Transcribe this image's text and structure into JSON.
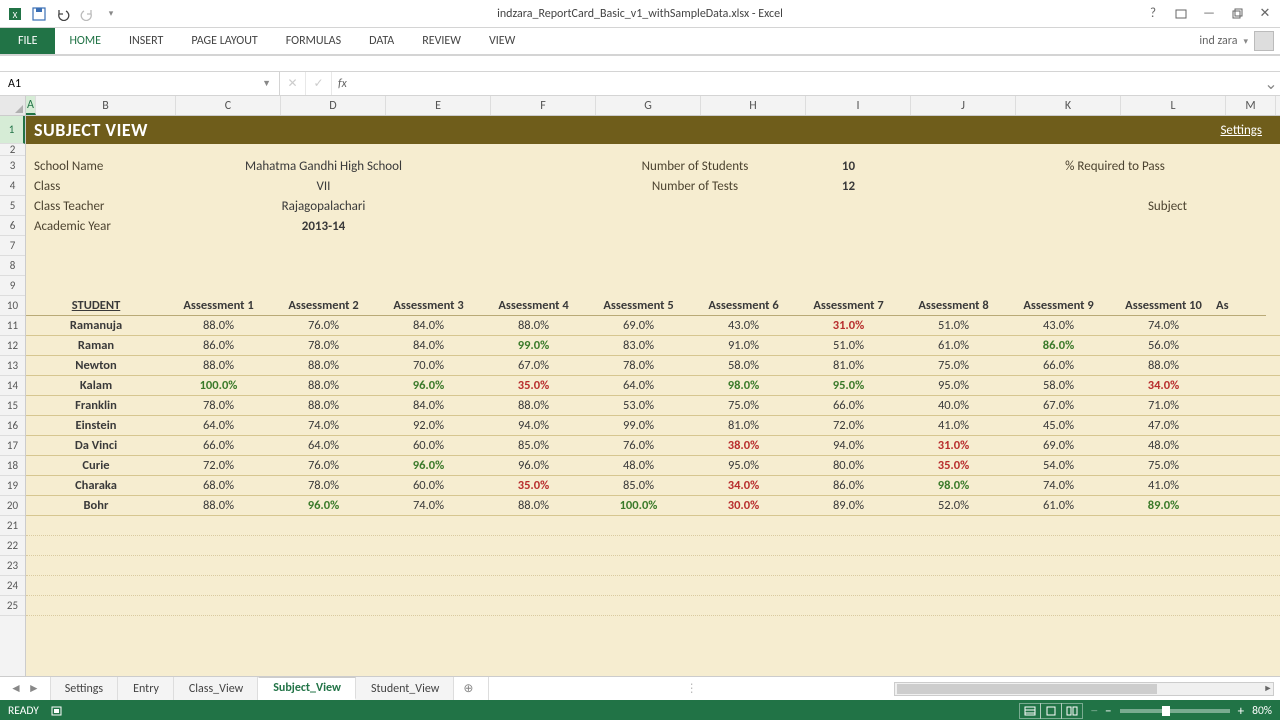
{
  "app": {
    "title_full": "indzara_ReportCard_Basic_v1_withSampleData.xlsx - Excel",
    "user_name": "ind zara"
  },
  "ribbon": {
    "file": "FILE",
    "tabs": [
      "HOME",
      "INSERT",
      "PAGE LAYOUT",
      "FORMULAS",
      "DATA",
      "REVIEW",
      "VIEW"
    ]
  },
  "formula_bar": {
    "name_box": "A1",
    "fx_label": "fx",
    "formula": ""
  },
  "columns": [
    "A",
    "B",
    "C",
    "D",
    "E",
    "F",
    "G",
    "H",
    "I",
    "J",
    "K",
    "L",
    "M"
  ],
  "sheet": {
    "title": "SUBJECT VIEW",
    "settings_link": "Settings",
    "info_labels": {
      "school": "School Name",
      "class": "Class",
      "teacher": "Class Teacher",
      "year": "Academic Year",
      "num_students": "Number of Students",
      "num_tests": "Number of Tests",
      "pct_pass": "% Required to Pass",
      "subject": "Subject"
    },
    "info_values": {
      "school": "Mahatma Gandhi High School",
      "class": "VII",
      "teacher": "Rajagopalachari",
      "year": "2013-14",
      "num_students": "10",
      "num_tests": "12"
    },
    "headers": [
      "STUDENT",
      "Assessment 1",
      "Assessment 2",
      "Assessment 3",
      "Assessment 4",
      "Assessment 5",
      "Assessment 6",
      "Assessment 7",
      "Assessment 8",
      "Assessment 9",
      "Assessment 10",
      "As"
    ],
    "students": [
      {
        "name": "Ramanuja",
        "v": [
          "88.0%",
          "76.0%",
          "84.0%",
          "88.0%",
          "69.0%",
          "43.0%",
          "31.0%",
          "51.0%",
          "43.0%",
          "74.0%"
        ],
        "c": [
          "",
          "",
          "",
          "",
          "",
          "",
          "red",
          "",
          "",
          ""
        ]
      },
      {
        "name": "Raman",
        "v": [
          "86.0%",
          "78.0%",
          "84.0%",
          "99.0%",
          "83.0%",
          "91.0%",
          "51.0%",
          "61.0%",
          "86.0%",
          "56.0%"
        ],
        "c": [
          "",
          "",
          "",
          "green",
          "",
          "",
          "",
          "",
          "green",
          ""
        ]
      },
      {
        "name": "Newton",
        "v": [
          "88.0%",
          "88.0%",
          "70.0%",
          "67.0%",
          "78.0%",
          "58.0%",
          "81.0%",
          "75.0%",
          "66.0%",
          "88.0%"
        ],
        "c": [
          "",
          "",
          "",
          "",
          "",
          "",
          "",
          "",
          "",
          ""
        ]
      },
      {
        "name": "Kalam",
        "v": [
          "100.0%",
          "88.0%",
          "96.0%",
          "35.0%",
          "64.0%",
          "98.0%",
          "95.0%",
          "95.0%",
          "58.0%",
          "34.0%"
        ],
        "c": [
          "green",
          "",
          "green",
          "red",
          "",
          "green",
          "green",
          "",
          "",
          "red"
        ]
      },
      {
        "name": "Franklin",
        "v": [
          "78.0%",
          "88.0%",
          "84.0%",
          "88.0%",
          "53.0%",
          "75.0%",
          "66.0%",
          "40.0%",
          "67.0%",
          "71.0%"
        ],
        "c": [
          "",
          "",
          "",
          "",
          "",
          "",
          "",
          "",
          "",
          ""
        ]
      },
      {
        "name": "Einstein",
        "v": [
          "64.0%",
          "74.0%",
          "92.0%",
          "94.0%",
          "99.0%",
          "81.0%",
          "72.0%",
          "41.0%",
          "45.0%",
          "47.0%"
        ],
        "c": [
          "",
          "",
          "",
          "",
          "",
          "",
          "",
          "",
          "",
          ""
        ]
      },
      {
        "name": "Da Vinci",
        "v": [
          "66.0%",
          "64.0%",
          "60.0%",
          "85.0%",
          "76.0%",
          "38.0%",
          "94.0%",
          "31.0%",
          "69.0%",
          "48.0%"
        ],
        "c": [
          "",
          "",
          "",
          "",
          "",
          "red",
          "",
          "red",
          "",
          ""
        ]
      },
      {
        "name": "Curie",
        "v": [
          "72.0%",
          "76.0%",
          "96.0%",
          "96.0%",
          "48.0%",
          "95.0%",
          "80.0%",
          "35.0%",
          "54.0%",
          "75.0%"
        ],
        "c": [
          "",
          "",
          "green",
          "",
          "",
          "",
          "",
          "red",
          "",
          ""
        ]
      },
      {
        "name": "Charaka",
        "v": [
          "68.0%",
          "78.0%",
          "60.0%",
          "35.0%",
          "85.0%",
          "34.0%",
          "86.0%",
          "98.0%",
          "74.0%",
          "41.0%"
        ],
        "c": [
          "",
          "",
          "",
          "red",
          "",
          "red",
          "",
          "green",
          "",
          ""
        ]
      },
      {
        "name": "Bohr",
        "v": [
          "88.0%",
          "96.0%",
          "74.0%",
          "88.0%",
          "100.0%",
          "30.0%",
          "89.0%",
          "52.0%",
          "61.0%",
          "89.0%"
        ],
        "c": [
          "",
          "green",
          "",
          "",
          "green",
          "red",
          "",
          "",
          "",
          "green"
        ]
      }
    ]
  },
  "sheet_tabs": {
    "tabs": [
      "Settings",
      "Entry",
      "Class_View",
      "Subject_View",
      "Student_View"
    ],
    "active": "Subject_View"
  },
  "status": {
    "ready": "READY",
    "zoom": "80%"
  }
}
